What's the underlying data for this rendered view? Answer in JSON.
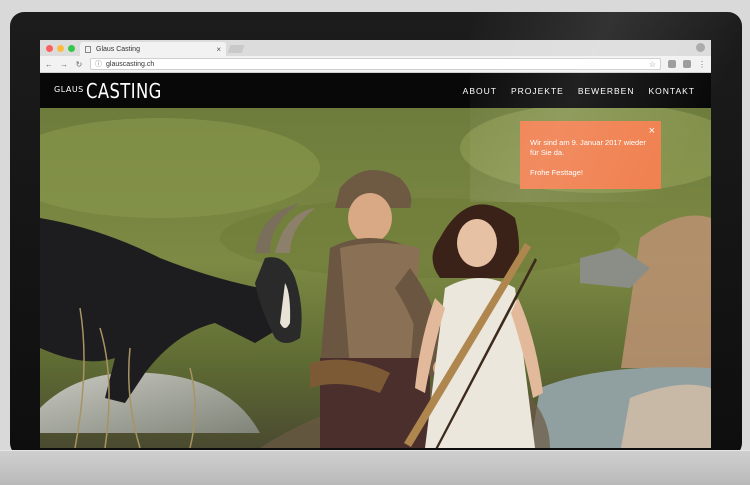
{
  "browser": {
    "tab_title": "Glaus Casting",
    "url": "glauscasting.ch"
  },
  "site": {
    "logo_small": "GLAUS",
    "logo_big": "CASTING",
    "nav": [
      {
        "label": "ABOUT"
      },
      {
        "label": "PROJEKTE"
      },
      {
        "label": "BEWERBEN"
      },
      {
        "label": "KONTAKT"
      }
    ]
  },
  "notice": {
    "line1": "Wir sind am 9. Januar 2017 wieder für Sie da.",
    "line2": "Frohe Festtage!",
    "accent": "#f07f4e"
  }
}
